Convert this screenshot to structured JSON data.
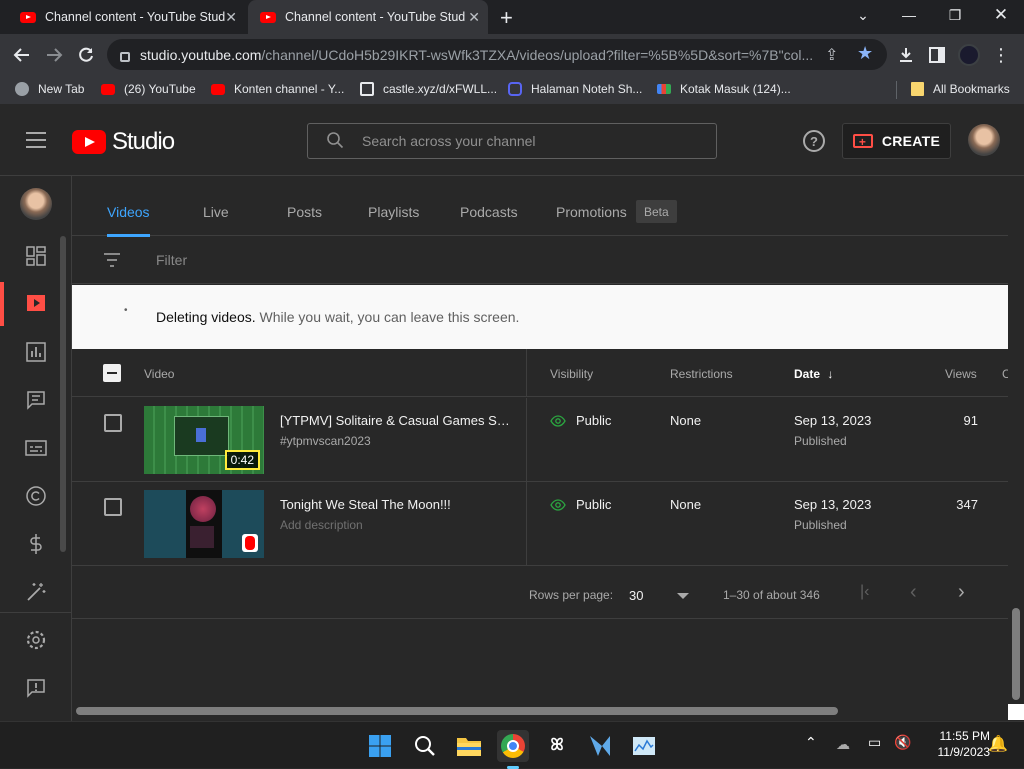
{
  "browser": {
    "tabs": [
      {
        "title": "Channel content - YouTube Stud"
      },
      {
        "title": "Channel content - YouTube Stud"
      }
    ],
    "new_tab_symbol": "+",
    "url_host": "studio.youtube.com",
    "url_rest": "/channel/UCdoH5b29IKRT-wsWfk3TZXA/videos/upload?filter=%5B%5D&sort=%7B\"col...",
    "bookmarks": [
      {
        "label": "New Tab",
        "icon": "globe-icon",
        "color": "#9aa0a6"
      },
      {
        "label": "(26) YouTube",
        "icon": "youtube-icon",
        "color": "#ff0000"
      },
      {
        "label": "Konten channel - Y...",
        "icon": "youtube-icon",
        "color": "#ff0000"
      },
      {
        "label": "castle.xyz/d/xFWLL...",
        "icon": "castle-icon",
        "color": "#e8eaed"
      },
      {
        "label": "Halaman Noteh Sh...",
        "icon": "discord-icon",
        "color": "#5865f2"
      },
      {
        "label": "Kotak Masuk (124)...",
        "icon": "gmail-icon",
        "color": "#ea4335"
      },
      {
        "label": "All Bookmarks",
        "icon": "folder-icon",
        "color": "#f9d66f"
      }
    ]
  },
  "studio": {
    "logo_text": "Studio",
    "search_placeholder": "Search across your channel",
    "create_label": "CREATE"
  },
  "content_tabs": [
    {
      "label": "Videos",
      "active": true
    },
    {
      "label": "Live"
    },
    {
      "label": "Posts"
    },
    {
      "label": "Playlists"
    },
    {
      "label": "Podcasts"
    },
    {
      "label": "Promotions"
    }
  ],
  "beta_label": "Beta",
  "filter_placeholder": "Filter",
  "notice": {
    "bold": "Deleting videos.",
    "text": " While you wait, you can leave this screen."
  },
  "table": {
    "headers": {
      "video": "Video",
      "visibility": "Visibility",
      "restrictions": "Restrictions",
      "date": "Date",
      "views": "Views",
      "comments": "C"
    },
    "rows": [
      {
        "title": "[YTPMV] Solitaire & Casual Games Sc...",
        "description": "#ytpmvscan2023",
        "duration": "0:42",
        "visibility": "Public",
        "restrictions": "None",
        "date": "Sep 13, 2023",
        "status": "Published",
        "views": "91"
      },
      {
        "title": "Tonight We Steal The Moon!!!",
        "description": "Add description",
        "visibility": "Public",
        "restrictions": "None",
        "date": "Sep 13, 2023",
        "status": "Published",
        "views": "347"
      }
    ]
  },
  "pagination": {
    "rows_per_page_label": "Rows per page:",
    "rows_per_page": "30",
    "range": "1–30 of about 346"
  },
  "taskbar": {
    "time": "11:55 PM",
    "date": "11/9/2023"
  },
  "colors": {
    "accent_blue": "#3ea6ff",
    "youtube_red": "#ff0000",
    "active_nav": "#ff4e45",
    "public_green": "#2ba640"
  }
}
